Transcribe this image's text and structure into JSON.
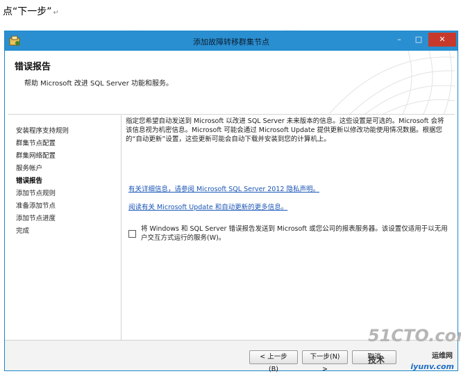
{
  "doc": {
    "caption": "点“下一步”",
    "paragraph_mark": "↵",
    "bg_fragment": "……"
  },
  "window": {
    "title": "添加故障转移群集节点",
    "icons": {
      "app": "wizard-app-icon",
      "minimize": "minimize-icon",
      "maximize": "maximize-icon",
      "close": "close-icon"
    }
  },
  "header": {
    "title": "错误报告",
    "subtitle": "帮助 Microsoft 改进 SQL Server 功能和服务。"
  },
  "sidebar": {
    "steps": [
      {
        "label": "安装程序支持规则",
        "active": false
      },
      {
        "label": "群集节点配置",
        "active": false
      },
      {
        "label": "群集网络配置",
        "active": false
      },
      {
        "label": "服务帐户",
        "active": false
      },
      {
        "label": "错误报告",
        "active": true
      },
      {
        "label": "添加节点规则",
        "active": false
      },
      {
        "label": "准备添加节点",
        "active": false
      },
      {
        "label": "添加节点进度",
        "active": false
      },
      {
        "label": "完成",
        "active": false
      }
    ]
  },
  "content": {
    "description": "指定您希望自动发送到 Microsoft 以改进 SQL Server 未来版本的信息。这些设置是可选的。Microsoft 会将该信息视为机密信息。Microsoft 可能会通过 Microsoft Update 提供更新以修改功能使用情况数据。根据您的“自动更新”设置，这些更新可能会自动下载并安装到您的计算机上。",
    "privacy_link": "有关详细信息，请参阅 Microsoft SQL Server 2012 隐私声明。",
    "update_link": "阅读有关 Microsoft Update 和自动更新的更多信息。",
    "error_report_checkbox": {
      "checked": false,
      "label": "将 Windows 和 SQL Server 错误报告发送到 Microsoft 或您公司的报表服务器。该设置仅适用于以无用户交互方式运行的服务(W)。"
    }
  },
  "footer": {
    "back_label": "< 上一步(B)",
    "next_label": "下一步(N) >",
    "cancel_label": "取消"
  },
  "watermark": {
    "site": "51CTO.com",
    "tagline": "技术",
    "blog": "运维网",
    "url": "iyunv.com"
  },
  "colors": {
    "titlebar": "#2a8fd1",
    "close_button": "#c7392b",
    "link": "#1a55b6",
    "window_border": "#1b86c8"
  }
}
